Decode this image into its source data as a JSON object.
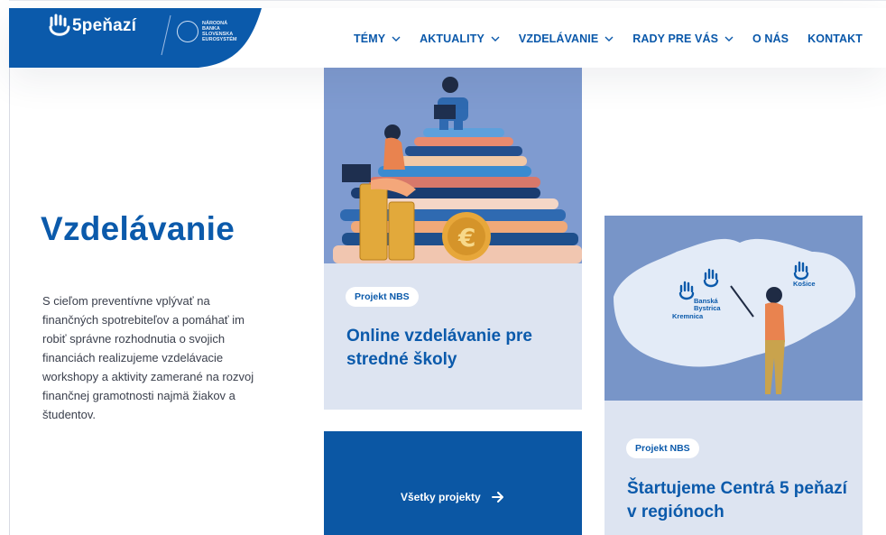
{
  "brand": {
    "logo_text": "5peňazí",
    "nbs_lines": [
      "NÁRODNÁ",
      "BANKA",
      "SLOVENSKA",
      "EUROSYSTÉM"
    ]
  },
  "nav": {
    "items": [
      {
        "label": "TÉMY",
        "has_dropdown": true
      },
      {
        "label": "AKTUALITY",
        "has_dropdown": true
      },
      {
        "label": "VZDELÁVANIE",
        "has_dropdown": true
      },
      {
        "label": "RADY PRE VÁS",
        "has_dropdown": true
      },
      {
        "label": "O NÁS",
        "has_dropdown": false
      },
      {
        "label": "KONTAKT",
        "has_dropdown": false
      }
    ]
  },
  "page": {
    "title": "Vzdelávanie",
    "intro": "S cieľom preventívne vplývať na finančných spotrebiteľov a pomáhať im robiť správne rozhodnutia o svojich financiách realizujeme vzdelávacie workshopy a aktivity zamerané na rozvoj finančnej gramotnosti najmä žiakov a študentov."
  },
  "cards": [
    {
      "badge": "Projekt NBS",
      "title": "Online vzdelávanie pre stredné školy"
    },
    {
      "badge": "Projekt NBS",
      "title": "Štartujeme Centrá 5 peňazí v regiónoch"
    }
  ],
  "map_labels": {
    "city_1a": "Banská",
    "city_1b": "Bystrica",
    "city_2": "Kremnica",
    "city_3": "Košice"
  },
  "all_projects": {
    "label": "Všetky projekty"
  },
  "colors": {
    "brand_blue": "#0b5aab",
    "card_bg": "#dde4f1",
    "illustration_sky": "#7895c8"
  }
}
